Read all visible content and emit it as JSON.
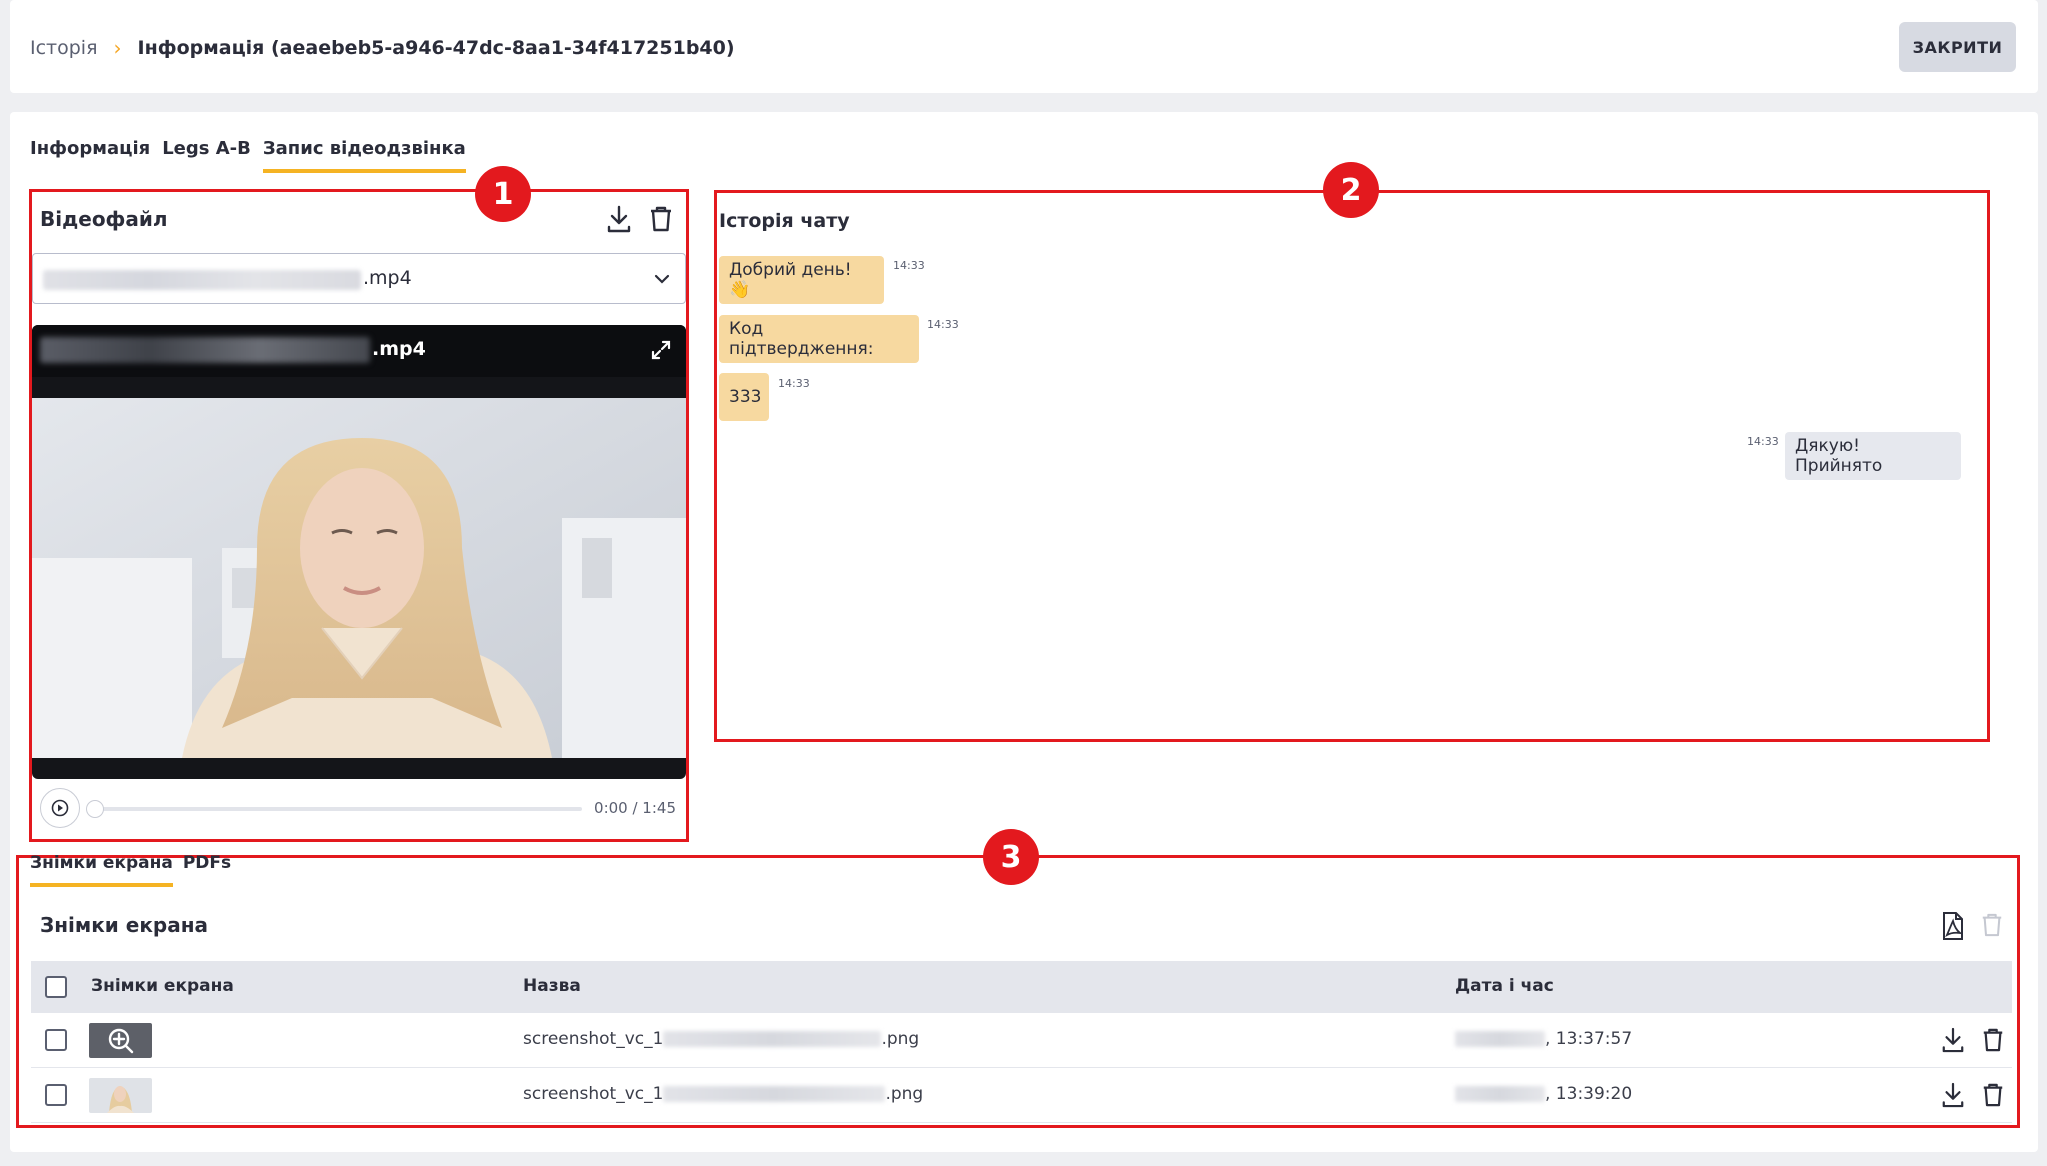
{
  "header": {
    "breadcrumb_root": "Історія",
    "breadcrumb_sep": "›",
    "breadcrumb_current": "Інформація (aeaebeb5-a946-47dc-8aa1-34f417251b40)",
    "close_label": "ЗАКРИТИ"
  },
  "tabs": [
    {
      "label": "Інформація"
    },
    {
      "label": "Legs A-B"
    },
    {
      "label": "Запис відеодзвінка"
    }
  ],
  "markers": [
    "1",
    "2",
    "3"
  ],
  "video": {
    "title": "Відеофайл",
    "file_ext": ".mp4",
    "player_ext": ".mp4",
    "time": "0:00 / 1:45",
    "progress": 0
  },
  "chat": {
    "title": "Історія чату",
    "messages": [
      {
        "text": "Добрий день! 👋",
        "time": "14:33",
        "direction": "in"
      },
      {
        "text": "Код підтвердження:",
        "time": "14:33",
        "direction": "in"
      },
      {
        "text": "333",
        "time": "14:33",
        "direction": "in"
      },
      {
        "text": "Дякую! Прийнято",
        "time": "14:33",
        "direction": "out"
      }
    ]
  },
  "screens": {
    "tabs": [
      {
        "label": "Знімки екрана"
      },
      {
        "label": "PDFs"
      }
    ],
    "title": "Знімки екрана",
    "columns": [
      "Знімки екрана",
      "Назва",
      "Дата і час"
    ],
    "rows": [
      {
        "name_prefix": "screenshot_vc_1",
        "name_suffix": ".png",
        "time": ", 13:37:57"
      },
      {
        "name_prefix": "screenshot_vc_1",
        "name_suffix": ".png",
        "time": ", 13:39:20"
      }
    ]
  },
  "colors": {
    "accent": "#f5b323",
    "annotation_red": "#e3191e",
    "chat_in": "#f7d9a0",
    "chat_out": "#e6e8ee"
  }
}
